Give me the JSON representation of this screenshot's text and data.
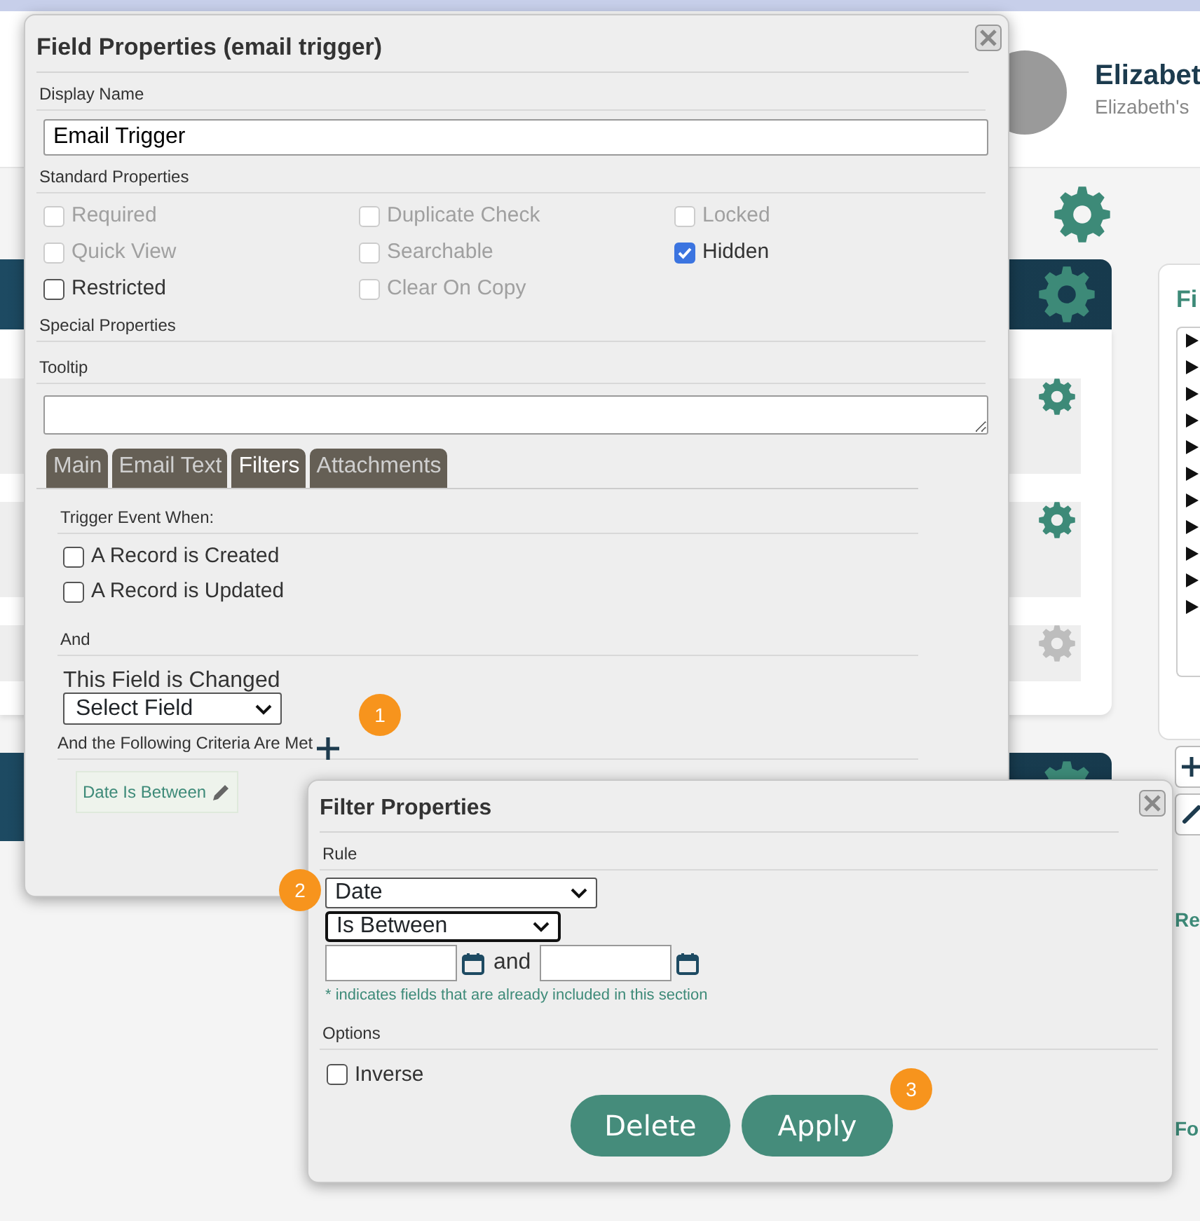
{
  "header": {
    "user_name": "Elizabet",
    "user_subtitle": "Elizabeth's"
  },
  "right_panel": {
    "sections": [
      "Fi",
      "Re",
      "Fo"
    ]
  },
  "field_dialog": {
    "title": "Field Properties (email trigger)",
    "display_name_label": "Display Name",
    "display_name": "Email Trigger",
    "standard_label": "Standard Properties",
    "properties": [
      {
        "label": "Required",
        "checked": false,
        "disabled": true
      },
      {
        "label": "Duplicate Check",
        "checked": false,
        "disabled": true
      },
      {
        "label": "Locked",
        "checked": false,
        "disabled": true
      },
      {
        "label": "Quick View",
        "checked": false,
        "disabled": true
      },
      {
        "label": "Searchable",
        "checked": false,
        "disabled": true
      },
      {
        "label": "Hidden",
        "checked": true,
        "disabled": false
      },
      {
        "label": "Restricted",
        "checked": false,
        "disabled": false
      },
      {
        "label": "Clear On Copy",
        "checked": false,
        "disabled": true
      }
    ],
    "special_label": "Special Properties",
    "tooltip_label": "Tooltip",
    "tabs": [
      {
        "label": "Main",
        "selected": false
      },
      {
        "label": "Email Text",
        "selected": false
      },
      {
        "label": "Filters",
        "selected": true
      },
      {
        "label": "Attachments",
        "selected": false
      }
    ],
    "trigger_label": "Trigger Event When:",
    "triggers": [
      {
        "label": "A Record is Created",
        "checked": false
      },
      {
        "label": "A Record is Updated",
        "checked": false
      }
    ],
    "and_label": "And",
    "field_changed_label": "This Field is Changed",
    "field_select": "Select Field",
    "criteria_label": "And the Following Criteria Are Met",
    "criteria": [
      {
        "label": "Date Is Between"
      }
    ]
  },
  "filter_dialog": {
    "title": "Filter Properties",
    "rule_label": "Rule",
    "field": "Date",
    "operator": "Is Between",
    "and_text": "and",
    "note": "* indicates fields that are already included in this section",
    "options_label": "Options",
    "inverse": {
      "label": "Inverse",
      "checked": false
    },
    "buttons": [
      "Delete",
      "Apply"
    ]
  },
  "callouts": [
    "1",
    "2",
    "3"
  ]
}
